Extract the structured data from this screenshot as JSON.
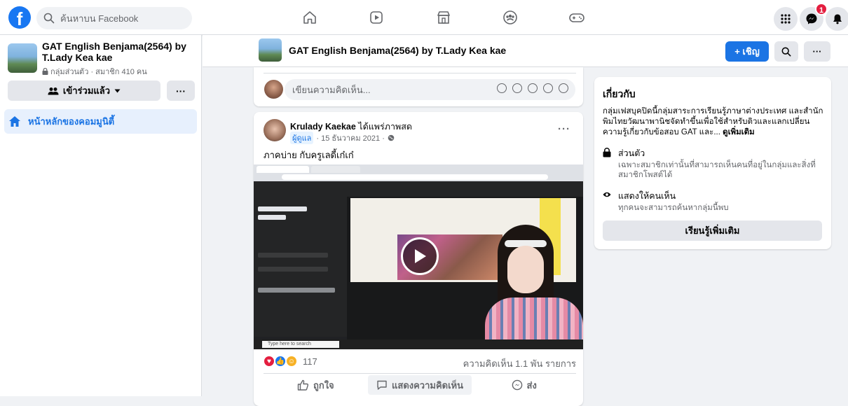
{
  "topbar": {
    "logo": "f",
    "search_placeholder": "ค้นหาบน Facebook",
    "nav_icons": [
      "home-icon",
      "watch-icon",
      "marketplace-icon",
      "groups-icon",
      "gaming-icon"
    ],
    "messenger_badge": "1"
  },
  "sidebar": {
    "group_title": "GAT English Benjama(2564) by T.Lady Kea kae",
    "group_meta": "กลุ่มส่วนตัว · สมาชิก 410 คน",
    "joined_label": "เข้าร่วมแล้ว",
    "more_label": "···",
    "nav_home_label": "หน้าหลักของคอมมูนิตี้"
  },
  "group_header": {
    "title": "GAT English Benjama(2564) by T.Lady Kea kae",
    "invite_label": "+ เชิญ",
    "more_label": "···"
  },
  "composer": {
    "placeholder": "เขียนความคิดเห็น..."
  },
  "post": {
    "author": "Krulady Kaekae",
    "action": "ได้แพร่ภาพสด",
    "admin_tag": "ผู้ดูแล",
    "date": "· 15 ธันวาคม 2021 ·",
    "more_label": "···",
    "text": "ภาคบ่าย กับครูเลดี้เก๋เก๋",
    "video_search_text": "Type here to search",
    "reaction_count": "117",
    "comments_count": "ความคิดเห็น 1.1 พัน รายการ",
    "actions": {
      "like": "ถูกใจ",
      "comment": "แสดงความคิดเห็น",
      "share": "ส่ง"
    }
  },
  "about": {
    "title": "เกี่ยวกับ",
    "description": "กลุ่มเฟสบุคปิดนี้กลุ่มสาระการเรียนรู้ภาษาต่างประเทศ และสำนักพิมไทยวัฒนาพานิชจัดทำขึ้นเพื่อใช้สำหรับติวและแลกเปลี่ยนความรู้เกี่ยวกับข้อสอบ GAT และ...",
    "see_more": "ดูเพิ่มเติม",
    "private_title": "ส่วนตัว",
    "private_desc": "เฉพาะสมาชิกเท่านั้นที่สามารถเห็นคนที่อยู่ในกลุ่มและสิ่งที่สมาชิกโพสต์ได้",
    "visible_title": "แสดงให้คนเห็น",
    "visible_desc": "ทุกคนจะสามารถค้นหากลุ่มนี้พบ",
    "learn_more_label": "เรียนรู้เพิ่มเติม"
  },
  "colors": {
    "brand": "#1877f2",
    "accent": "#1b74e4",
    "badge": "#e41e3f"
  }
}
